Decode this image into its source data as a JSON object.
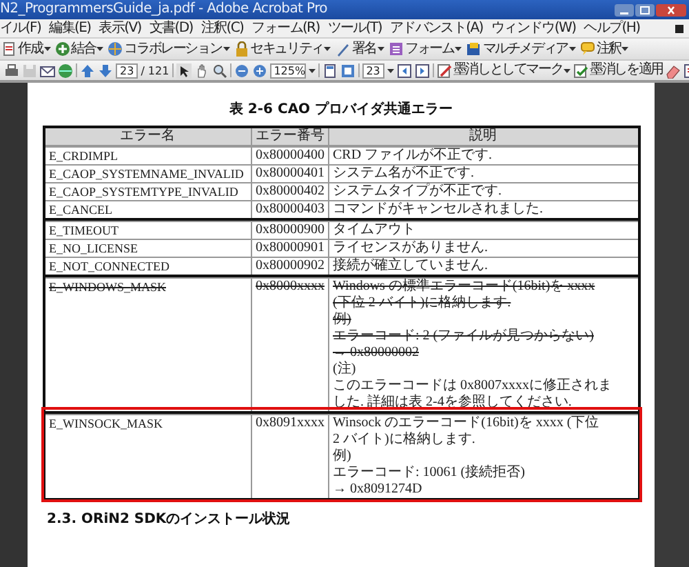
{
  "window": {
    "title": "N2_ProgrammersGuide_ja.pdf - Adobe Acrobat Pro"
  },
  "menu": [
    "イル(F)",
    "編集(E)",
    "表示(V)",
    "文書(D)",
    "注釈(C)",
    "フォーム(R)",
    "ツール(T)",
    "アドバンスト(A)",
    "ウィンドウ(W)",
    "ヘルプ(H)"
  ],
  "tasks_toolbar": [
    {
      "label": "作成",
      "dropdown": true
    },
    {
      "label": "結合",
      "dropdown": true
    },
    {
      "label": "コラボレーション",
      "dropdown": true
    },
    {
      "label": "セキュリティ",
      "dropdown": true
    },
    {
      "label": "署名",
      "dropdown": true
    },
    {
      "label": "フォーム",
      "dropdown": true
    },
    {
      "label": "マルチメディア",
      "dropdown": true
    },
    {
      "label": "注釈",
      "dropdown": true
    }
  ],
  "nav_toolbar": {
    "page_field": "23",
    "page_total": "/ 121",
    "zoom_field": "125%",
    "find_field": "23",
    "buttons": [
      {
        "label": "墨消しとしてマーク",
        "dropdown": true
      },
      {
        "label": "墨消しを適用",
        "dropdown": false
      }
    ]
  },
  "document": {
    "table_title": "表 2-6 CAO プロバイダ共通エラー",
    "columns": [
      "エラー名",
      "エラー番号",
      "説明"
    ],
    "groups": [
      {
        "highlighted": false,
        "rows": [
          {
            "name": "E_CRDIMPL",
            "code": "0x80000400",
            "struck": false,
            "description": [
              "CRD ファイルが不正です."
            ]
          },
          {
            "name": "E_CAOP_SYSTEMNAME_INVALID",
            "code": "0x80000401",
            "struck": false,
            "description": [
              "システム名が不正です."
            ]
          },
          {
            "name": "E_CAOP_SYSTEMTYPE_INVALID",
            "code": "0x80000402",
            "struck": false,
            "description": [
              "システムタイプが不正です."
            ]
          },
          {
            "name": "E_CANCEL",
            "code": "0x80000403",
            "struck": false,
            "description": [
              "コマンドがキャンセルされました."
            ]
          }
        ]
      },
      {
        "highlighted": false,
        "rows": [
          {
            "name": "E_TIMEOUT",
            "code": "0x80000900",
            "struck": false,
            "description": [
              "タイムアウト"
            ]
          },
          {
            "name": "E_NO_LICENSE",
            "code": "0x80000901",
            "struck": false,
            "description": [
              "ライセンスがありません."
            ]
          },
          {
            "name": "E_NOT_CONNECTED",
            "code": "0x80000902",
            "struck": false,
            "description": [
              "接続が確立していません."
            ]
          }
        ]
      },
      {
        "highlighted": false,
        "rows": [
          {
            "name": "E_WINDOWS_MASK",
            "code": "0x8000xxxx",
            "struck": true,
            "description": [
              "Windows の標準エラーコード(16bit)を xxxx",
              "(下位 2 バイト)に格納します.",
              "例)",
              "エラーコード: 2 (ファイルが見つからない)",
              "→ 0x80000002"
            ]
          }
        ],
        "notes": [
          "(注)",
          "このエラーコードは 0x8007xxxxに修正されま",
          "した. 詳細は表 2-4を参照してください."
        ]
      },
      {
        "highlighted": true,
        "rows": [
          {
            "name": "E_WINSOCK_MASK",
            "code": "0x8091xxxx",
            "struck": false,
            "description": [
              "Winsock のエラーコード(16bit)を xxxx (下位",
              "2 バイト)に格納します.",
              "例)",
              "エラーコード: 10061 (接続拒否)",
              "→ 0x8091274D"
            ]
          }
        ]
      }
    ],
    "section_heading": "2.3. ORiN2 SDKのインストール状況"
  }
}
